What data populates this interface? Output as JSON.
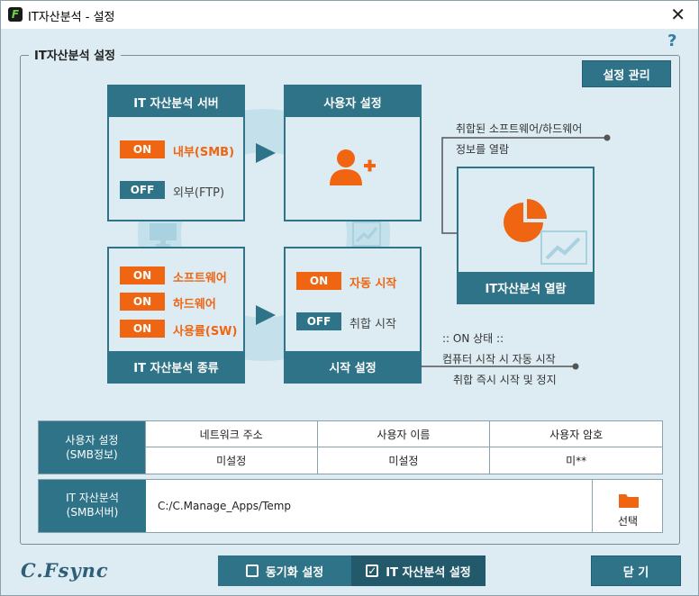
{
  "window": {
    "title": "IT자산분석 - 설정",
    "app_icon": "F"
  },
  "group_title": "IT자산분석 설정",
  "help_label": "?",
  "manage_button": "설정 관리",
  "server_box": {
    "title": "IT 자산분석 서버",
    "options": [
      {
        "state": "ON",
        "label": "내부(SMB)"
      },
      {
        "state": "OFF",
        "label": "외부(FTP)"
      }
    ]
  },
  "user_box": {
    "title": "사용자 설정"
  },
  "type_box": {
    "footer": "IT 자산분석 종류",
    "options": [
      {
        "state": "ON",
        "label": "소프트웨어"
      },
      {
        "state": "ON",
        "label": "하드웨어"
      },
      {
        "state": "ON",
        "label": "사용률(SW)"
      }
    ]
  },
  "start_box": {
    "footer": "시작 설정",
    "options": [
      {
        "state": "ON",
        "label": "자동 시작"
      },
      {
        "state": "OFF",
        "label": "취합 시작"
      }
    ]
  },
  "view_box": {
    "footer": "IT자산분석 열람"
  },
  "notes": {
    "view_line1": "취합된 소프트웨어/하드웨어",
    "view_line2": "정보를 열람",
    "on_title": ":: ON 상태 ::",
    "on_line1": "컴퓨터 시작 시 자동 시작",
    "on_line2": "취합 즉시 시작 및 정지"
  },
  "smb_table": {
    "row_head_line1": "사용자 설정",
    "row_head_line2": "(SMB정보)",
    "columns": [
      "네트워크 주소",
      "사용자 이름",
      "사용자 암호"
    ],
    "values": [
      "미설정",
      "미설정",
      "미**"
    ]
  },
  "server_path": {
    "head_line1": "IT 자산분석",
    "head_line2": "(SMB서버)",
    "path": "C:/C.Manage_Apps/Temp",
    "select_label": "선택"
  },
  "brand": "C.Fsync",
  "tabs": [
    {
      "label": "동기화 설정",
      "checked": false
    },
    {
      "label": "IT 자산분석 설정",
      "checked": true
    }
  ],
  "close_button": "닫 기",
  "colors": {
    "accent": "#2f7388",
    "on": "#f06512",
    "background": "#dcecf2"
  }
}
